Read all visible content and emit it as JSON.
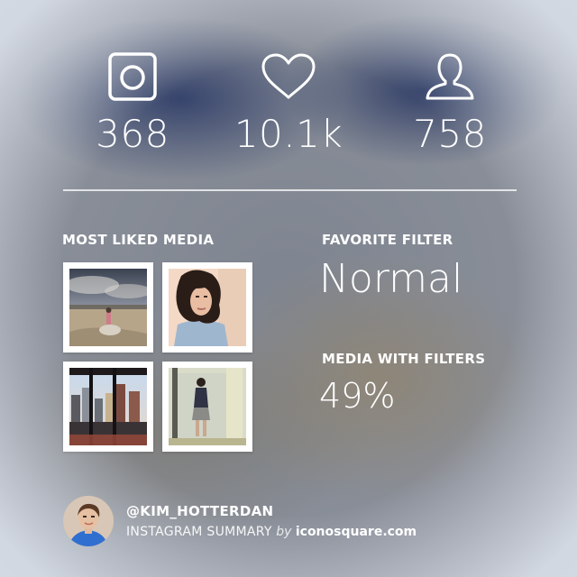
{
  "stats": {
    "media": {
      "icon": "instagram-camera-icon",
      "value": "368"
    },
    "likes": {
      "icon": "heart-icon",
      "value": "10.1k"
    },
    "followers": {
      "icon": "user-icon",
      "value": "758"
    }
  },
  "most_liked": {
    "label": "MOST LIKED MEDIA",
    "photos": [
      {
        "name": "desert-landscape-photo"
      },
      {
        "name": "curly-hair-selfie-photo"
      },
      {
        "name": "city-window-view-photo"
      },
      {
        "name": "mirror-selfie-photo"
      }
    ]
  },
  "favorite_filter": {
    "label": "FAVORITE FILTER",
    "value": "Normal"
  },
  "media_with_filters": {
    "label": "MEDIA WITH FILTERS",
    "value": "49%"
  },
  "footer": {
    "username": "@KIM_HOTTERDAN",
    "summary_label": "INSTAGRAM SUMMARY",
    "by": "by",
    "site": "iconosquare.com"
  }
}
